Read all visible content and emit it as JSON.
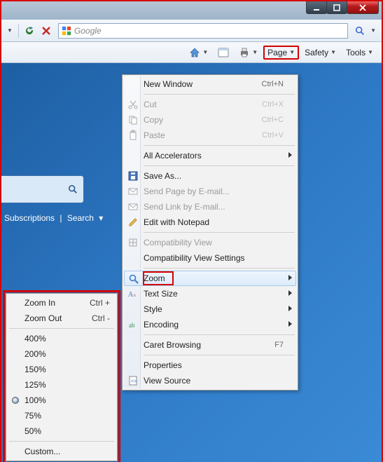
{
  "search": {
    "provider_label": "Google"
  },
  "cmdbar": {
    "page": "Page",
    "safety": "Safety",
    "tools": "Tools"
  },
  "page_nav": {
    "subscriptions": "Subscriptions",
    "search": "Search"
  },
  "page_menu": {
    "new_window": {
      "label": "New Window",
      "shortcut": "Ctrl+N"
    },
    "cut": {
      "label": "Cut",
      "shortcut": "Ctrl+X"
    },
    "copy": {
      "label": "Copy",
      "shortcut": "Ctrl+C"
    },
    "paste": {
      "label": "Paste",
      "shortcut": "Ctrl+V"
    },
    "all_accel": {
      "label": "All Accelerators"
    },
    "save_as": {
      "label": "Save As..."
    },
    "send_page": {
      "label": "Send Page by E-mail..."
    },
    "send_link": {
      "label": "Send Link by E-mail..."
    },
    "edit_notepad": {
      "label": "Edit with Notepad"
    },
    "compat_view": {
      "label": "Compatibility View"
    },
    "compat_settings": {
      "label": "Compatibility View Settings"
    },
    "zoom": {
      "label": "Zoom"
    },
    "text_size": {
      "label": "Text Size"
    },
    "style": {
      "label": "Style"
    },
    "encoding": {
      "label": "Encoding"
    },
    "caret": {
      "label": "Caret Browsing",
      "shortcut": "F7"
    },
    "properties": {
      "label": "Properties"
    },
    "view_source": {
      "label": "View Source"
    }
  },
  "zoom_menu": {
    "zoom_in": {
      "label": "Zoom In",
      "shortcut": "Ctrl +"
    },
    "zoom_out": {
      "label": "Zoom Out",
      "shortcut": "Ctrl -"
    },
    "p400": "400%",
    "p200": "200%",
    "p150": "150%",
    "p125": "125%",
    "p100": "100%",
    "p75": "75%",
    "p50": "50%",
    "custom": "Custom..."
  }
}
